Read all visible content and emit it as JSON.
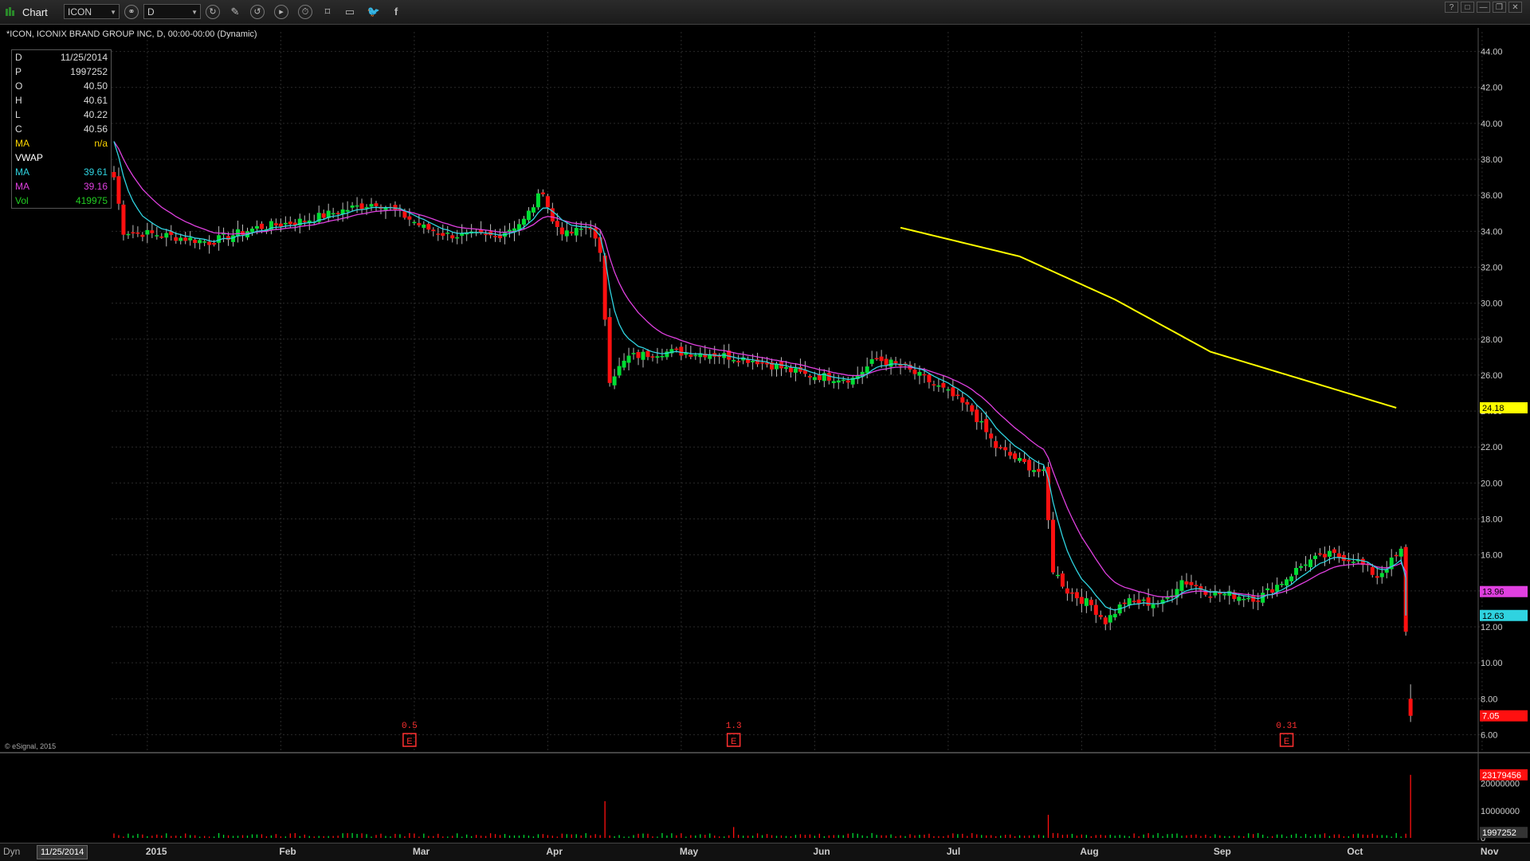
{
  "toolbar": {
    "title": "Chart",
    "symbol": "ICON",
    "interval": "D",
    "icons": [
      "link-icon",
      "refresh-icon",
      "cursor-icon",
      "draw-icon",
      "pan-icon",
      "play-icon",
      "timer-icon",
      "tag-icon",
      "comment-icon",
      "twitter-icon",
      "facebook-icon"
    ],
    "window_buttons": [
      "?",
      "□",
      "—",
      "❐",
      "✕"
    ]
  },
  "chart_header": "*ICON, ICONIX BRAND GROUP INC, D, 00:00-00:00 (Dynamic)",
  "legend": [
    {
      "key": "D",
      "value": "11/25/2014",
      "color": "#dddddd"
    },
    {
      "key": "P",
      "value": "1997252",
      "color": "#dddddd"
    },
    {
      "key": "O",
      "value": "40.50",
      "color": "#dddddd"
    },
    {
      "key": "H",
      "value": "40.61",
      "color": "#dddddd"
    },
    {
      "key": "L",
      "value": "40.22",
      "color": "#dddddd"
    },
    {
      "key": "C",
      "value": "40.56",
      "color": "#dddddd"
    },
    {
      "key": "MA",
      "value": "n/a",
      "color": "#ffd700"
    },
    {
      "key": "VWAP",
      "value": "",
      "color": "#ffffff"
    },
    {
      "key": "MA",
      "value": "39.61",
      "color": "#2fd3e0"
    },
    {
      "key": "MA",
      "value": "39.16",
      "color": "#e040e0"
    },
    {
      "key": "Vol",
      "value": "419975",
      "color": "#22cc22"
    }
  ],
  "watermark": "© eSignal, 2015",
  "bottom": {
    "mode": "Dyn",
    "date": "11/25/2014"
  },
  "colors": {
    "up": "#00dd33",
    "down": "#ff1010",
    "ma_fast": "#2fd3e0",
    "ma_slow": "#e040e0",
    "ma_long": "#ffff00",
    "grid": "#2a2a2a"
  },
  "earnings_markers": [
    {
      "label": "0.5",
      "day": 62
    },
    {
      "label": "1.3",
      "day": 130
    },
    {
      "label": "0.31",
      "day": 246
    }
  ],
  "chart_data": {
    "type": "candlestick",
    "x_labels": [
      "2015",
      "Feb",
      "Mar",
      "Apr",
      "May",
      "Jun",
      "Jul",
      "Aug",
      "Sep",
      "Oct",
      "Nov"
    ],
    "x_label_days": [
      12,
      40,
      68,
      96,
      124,
      152,
      180,
      208,
      236,
      264,
      292
    ],
    "y_ticks": [
      "44.00",
      "42.00",
      "40.00",
      "38.00",
      "36.00",
      "34.00",
      "32.00",
      "30.00",
      "28.00",
      "26.00",
      "24.00",
      "22.00",
      "20.00",
      "18.00",
      "16.00",
      "14.00",
      "12.00",
      "10.00",
      "8.00",
      "6.00"
    ],
    "ylim": [
      5,
      45
    ],
    "price_tags": [
      {
        "value": 24.18,
        "label": "24.18",
        "color": "#ffff00",
        "text": "#000000"
      },
      {
        "value": 13.96,
        "label": "13.96",
        "color": "#e040e0",
        "text": "#000000"
      },
      {
        "value": 12.63,
        "label": "12.63",
        "color": "#2fd3e0",
        "text": "#000000"
      },
      {
        "value": 7.05,
        "label": "7.05",
        "color": "#ff1010",
        "text": "#ffffff"
      }
    ],
    "close_anchors": [
      [
        0,
        37
      ],
      [
        2,
        34
      ],
      [
        10,
        33.8
      ],
      [
        20,
        33.4
      ],
      [
        30,
        34.2
      ],
      [
        40,
        34.6
      ],
      [
        50,
        35.3
      ],
      [
        55,
        35.6
      ],
      [
        60,
        35
      ],
      [
        65,
        34.2
      ],
      [
        70,
        33.8
      ],
      [
        80,
        33.7
      ],
      [
        86,
        34.6
      ],
      [
        90,
        36.3
      ],
      [
        92,
        34.5
      ],
      [
        95,
        33.8
      ],
      [
        100,
        34.3
      ],
      [
        102,
        32.6
      ],
      [
        104,
        25.8
      ],
      [
        108,
        27
      ],
      [
        115,
        27.3
      ],
      [
        125,
        27.2
      ],
      [
        135,
        26.8
      ],
      [
        145,
        26
      ],
      [
        155,
        25.8
      ],
      [
        160,
        26.9
      ],
      [
        165,
        26.5
      ],
      [
        170,
        25.8
      ],
      [
        175,
        25
      ],
      [
        180,
        24
      ],
      [
        185,
        22
      ],
      [
        190,
        21.2
      ],
      [
        195,
        20.5
      ],
      [
        197,
        15.2
      ],
      [
        200,
        14
      ],
      [
        205,
        13.2
      ],
      [
        208,
        12.3
      ],
      [
        212,
        13.4
      ],
      [
        220,
        13.3
      ],
      [
        224,
        14.6
      ],
      [
        230,
        13.9
      ],
      [
        240,
        13.6
      ],
      [
        245,
        14.5
      ],
      [
        250,
        15.6
      ],
      [
        255,
        16
      ],
      [
        260,
        15.8
      ],
      [
        265,
        14.8
      ],
      [
        270,
        16.2
      ],
      [
        272,
        7.05
      ]
    ],
    "ma_long_anchors": [
      [
        165,
        34.2
      ],
      [
        190,
        32.6
      ],
      [
        210,
        30.2
      ],
      [
        230,
        27.3
      ],
      [
        250,
        25.7
      ],
      [
        269,
        24.18
      ]
    ],
    "volume": {
      "ylim": [
        0,
        24000000
      ],
      "y_ticks": [
        "20000000",
        "10000000",
        "0"
      ],
      "tags": [
        {
          "value": 23179456,
          "label": "23179456",
          "color": "#ff1010",
          "text": "#ffffff"
        },
        {
          "value": 1997252,
          "label": "1997252",
          "color": "#333333",
          "text": "#ffffff"
        }
      ],
      "spikes": [
        [
          103,
          13500000
        ],
        [
          130,
          4000000
        ],
        [
          196,
          8500000
        ],
        [
          272,
          23179456
        ],
        [
          273,
          23000000
        ]
      ],
      "base": 1500000
    }
  }
}
